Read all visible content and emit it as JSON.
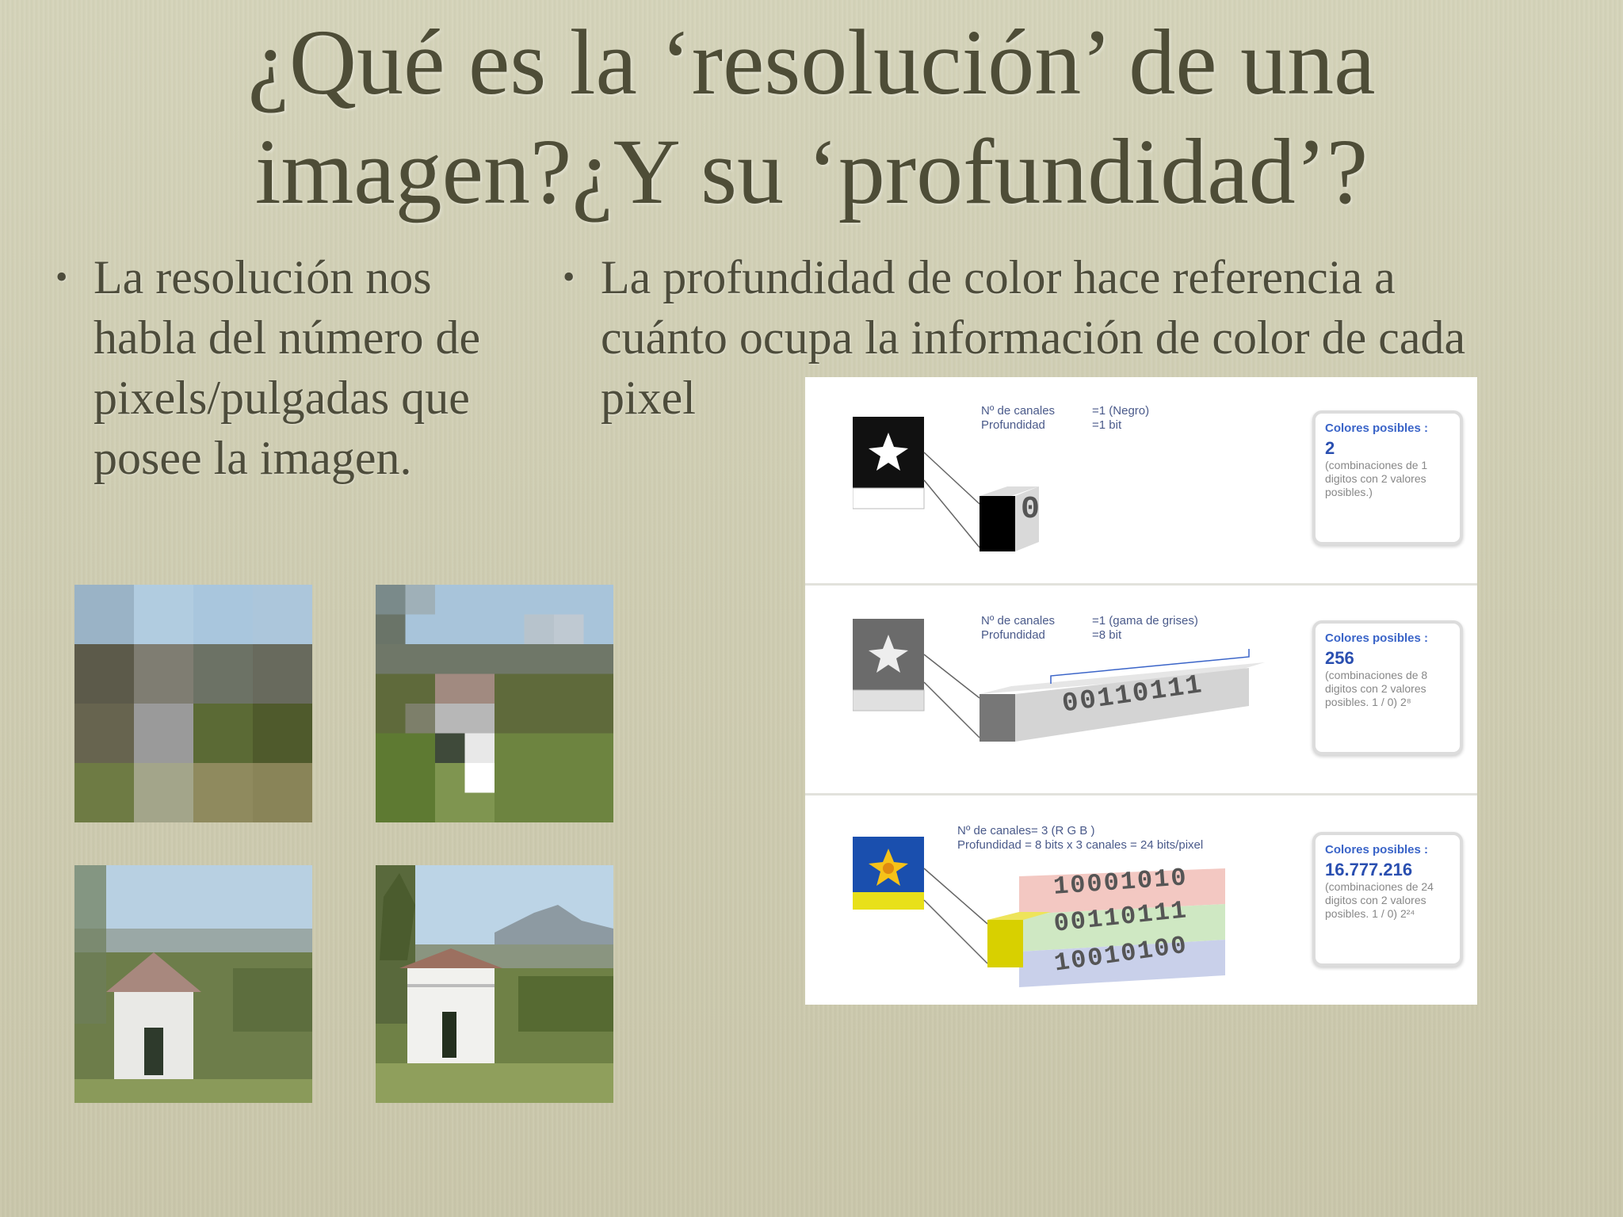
{
  "slide": {
    "title_line1": "¿Qué es la ‘resolución’ de una",
    "title_line2": "imagen?¿Y su ‘profundidad’?",
    "bullet1": "La resolución nos habla del número de pixels/pulgadas que posee la imagen.",
    "bullet2_line1": "La profundidad de color hace referencia a",
    "bullet2_line2": "cuánto ocupa la información de color de cada",
    "bullet2_line3": "pixel",
    "bullet_symbol": "•"
  },
  "depth_panel": {
    "rows": [
      {
        "channels_label": "Nº de canales",
        "channels_value": "=1 (Negro)",
        "depth_label": "Profundidad",
        "depth_value": "=1 bit",
        "bits": "0",
        "caption": "Colores posibles :",
        "count": "2",
        "desc": "(combinaciones de 1 digitos con 2 valores posibles.)"
      },
      {
        "channels_label": "Nº de canales",
        "channels_value": "=1 (gama de grises)",
        "depth_label": "Profundidad",
        "depth_value": "=8 bit",
        "bits": "00110111",
        "caption": "Colores posibles :",
        "count": "256",
        "desc": "(combinaciones de 8 digitos con 2 valores posibles. 1 / 0) 2⁸"
      },
      {
        "channels_label": "Nº de canales= 3 (R G B )",
        "depth_label": "Profundidad = 8 bits x 3 canales = 24 bits/pixel",
        "bits_r": "10001010",
        "bits_g": "00110111",
        "bits_b": "10010100",
        "caption": "Colores posibles :",
        "count": "16.777.216",
        "desc": "(combinaciones de 24 digitos con 2 valores posibles. 1 / 0) 2²⁴"
      }
    ]
  },
  "colors": {
    "background": "#cfcdb2",
    "title_text": "#4e4d37",
    "body_text": "#4d4c3b",
    "accent_blue": "#2a4fb0"
  }
}
